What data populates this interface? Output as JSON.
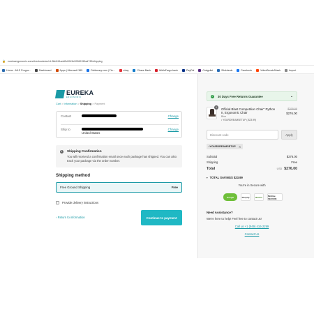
{
  "browser": {
    "url": "eurekaergonomic.com/checkouts/cn/c1-5bb241add2c0043e00360159ad?33/shipping",
    "bookmarks": [
      {
        "label": "Home - MLS Progra...",
        "color": "#2b6cb0"
      },
      {
        "label": "Dashboard",
        "color": "#444444"
      },
      {
        "label": "Apps | Microsoft 365",
        "color": "#d04a02"
      },
      {
        "label": "Dictionary.com | Fin...",
        "color": "#1a73e8"
      },
      {
        "label": "ebay",
        "color": "#e53238"
      },
      {
        "label": "Chase Bank",
        "color": "#117aca"
      },
      {
        "label": "WellsFargo bank",
        "color": "#d71e28"
      },
      {
        "label": "PayPal",
        "color": "#003087"
      },
      {
        "label": "Craigslist",
        "color": "#5a2d82"
      },
      {
        "label": "Slickdeals",
        "color": "#2a6db5"
      },
      {
        "label": "Facebook",
        "color": "#1877f2"
      },
      {
        "label": "VideoBench/Mask",
        "color": "#ff4500"
      },
      {
        "label": "Import",
        "color": "#888888"
      }
    ]
  },
  "brand": {
    "name": "EUREKA",
    "tagline": "ERGONOMIC",
    "accent": "#1a9aa6"
  },
  "breadcrumb": {
    "cart": "Cart",
    "information": "Information",
    "shipping": "Shipping",
    "payment": "Payment",
    "sep": ">"
  },
  "contact_block": {
    "contact_label": "Contact",
    "shipto_label": "Ship to",
    "shipto_country": "United States",
    "change_label": "Change"
  },
  "confirmation": {
    "title": "Shipping Confirmation",
    "message": "You will received a confirmation email once each package has shipped. You can also track your package via the order number."
  },
  "shipping": {
    "heading": "Shipping method",
    "option_label": "Free Ground Shipping",
    "option_price": "Free",
    "delivery_label": "Provide delivery instructions"
  },
  "nav": {
    "return_label": "Return to information",
    "continue_label": "Continue to payment"
  },
  "summary": {
    "guarantee": "30 Days Free Returns Guarantee",
    "product": {
      "qty": "1",
      "name": "Official Blast Competition Chair\" Python II, Ergonomic Chair",
      "variant": "Blue",
      "code": "YOURDREAMSETUP (-$23.99)",
      "old_price": "$299.99",
      "new_price": "$276.00"
    },
    "discount_placeholder": "Discount code",
    "apply_label": "Apply",
    "applied_code": "YOURDREAMSETUP",
    "subtotal_label": "Subtotal",
    "subtotal_value": "$276.00",
    "shipping_label": "Shipping",
    "shipping_value": "Free",
    "total_label": "Total",
    "total_currency": "USD",
    "total_value": "$276.00",
    "savings_label": "TOTAL SAVINGS",
    "savings_value": "$23.99",
    "secure_text": "You're in Secure with",
    "badges": [
      "Google",
      "Shopify",
      "Norton",
      "McAfee SECURE"
    ],
    "assist_title": "Need Assistance?",
    "assist_text": "We're here to help! Feel free to contact us!",
    "phone": "Call us +1 (949) 416-2299",
    "contact_link": "Contact Us"
  }
}
